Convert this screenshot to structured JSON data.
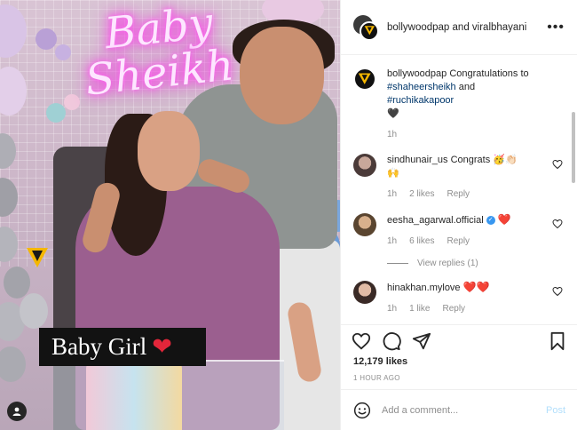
{
  "post": {
    "image": {
      "neon_line1": "Baby",
      "neon_line2": "Sheikh",
      "caption_overlay": "Baby Girl",
      "caption_emoji": "❤️",
      "watermark_icon": "viralbhayani-v-logo-icon",
      "user_tag_icon": "user-tag-icon"
    },
    "header": {
      "title": "bollywoodpap and viralbhayani",
      "more_icon": "more-options-icon"
    },
    "caption": {
      "username": "bollywoodpap",
      "text_prefix": "Congratulations to",
      "mention1": "#shaheersheikh",
      "joiner": "and",
      "mention2": "#ruchikakapoor",
      "emoji": "🖤",
      "time": "1h"
    },
    "comments": [
      {
        "username": "sindhunair_us",
        "text": "Congrats 🥳👏🏻",
        "line2": "🙌",
        "time": "1h",
        "likes": "2 likes",
        "reply": "Reply",
        "verified": false
      },
      {
        "username": "eesha_agarwal.official",
        "text": "❤️",
        "time": "1h",
        "likes": "6 likes",
        "reply": "Reply",
        "verified": true,
        "view_replies": "View replies (1)"
      },
      {
        "username": "hinakhan.mylove",
        "text": "❤️❤️",
        "time": "1h",
        "likes": "1 like",
        "reply": "Reply",
        "verified": false
      }
    ],
    "likes_count": "12,179 likes",
    "posted_ago": "1 HOUR AGO",
    "add_comment": {
      "placeholder": "Add a comment...",
      "post_label": "Post"
    },
    "colors": {
      "link": "#00376b",
      "muted": "#8e8e8e",
      "heart": "#ed4956",
      "post_button": "#b2dffc"
    }
  }
}
